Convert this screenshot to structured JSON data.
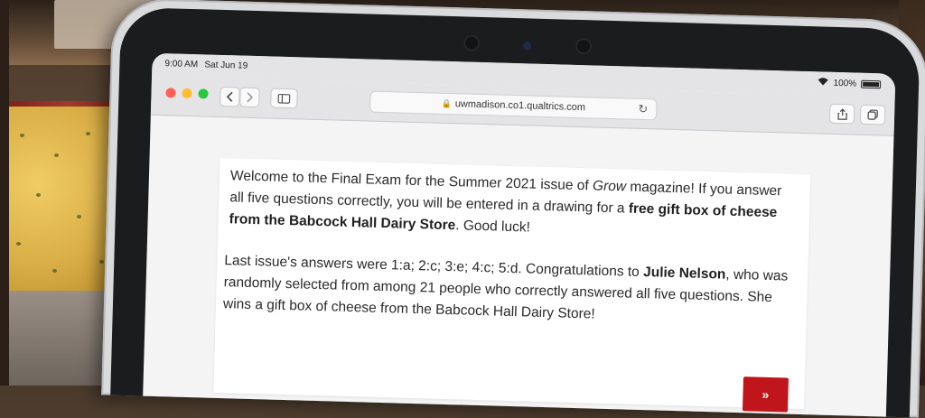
{
  "status_bar": {
    "time": "9:00 AM",
    "date": "Sat Jun 19",
    "battery": "100%"
  },
  "browser": {
    "url": "uwmadison.co1.qualtrics.com",
    "back_icon": "chevron-left-icon",
    "forward_icon": "chevron-right-icon",
    "sidebar_icon": "sidebar-icon",
    "share_icon": "share-icon",
    "tabs_icon": "tabs-icon",
    "traffic_colors": [
      "#ff5f57",
      "#febc2e",
      "#28c840"
    ]
  },
  "content": {
    "para1": {
      "a": "Welcome to the Final Exam for the Summer 2021 issue of ",
      "magazine": "Grow",
      "b": " magazine! If you answer all five questions correctly, you will be entered in a drawing for a ",
      "prize": "free gift box of cheese from the Babcock Hall Dairy Store",
      "c": ". Good luck!"
    },
    "para2": {
      "a": "Last issue's answers were 1:a; 2:c; 3:e; 4:c; 5:d. Congratulations to ",
      "winner": "Julie Nelson",
      "b": ", who was randomly selected from among 21 people who correctly answered all five questions. She wins a gift box of cheese from the Babcock Hall Dairy Store!"
    },
    "next_button": "»",
    "accent_color": "#c0161b"
  }
}
